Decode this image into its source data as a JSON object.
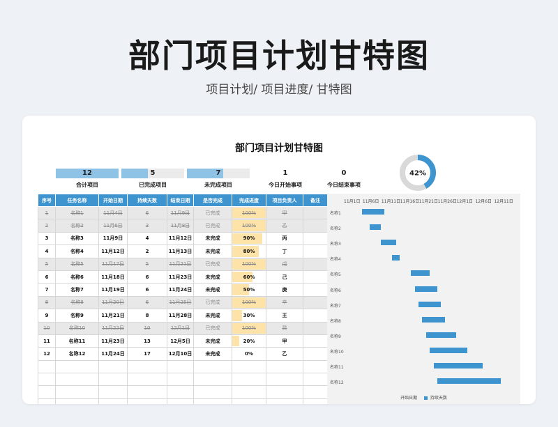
{
  "header": {
    "title": "部门项目计划甘特图",
    "subtitle": "项目计划/  项目进度/  甘特图"
  },
  "sheet": {
    "title": "部门项目计划甘特图"
  },
  "stats": [
    {
      "value": "12",
      "label": "合计项目",
      "fill": 1.0
    },
    {
      "value": "5",
      "label": "已完成项目",
      "fill": 0.42
    },
    {
      "value": "7",
      "label": "未完成项目",
      "fill": 0.58
    },
    {
      "value": "1",
      "label": "今日开始事项"
    },
    {
      "value": "0",
      "label": "今日结束事项"
    }
  ],
  "donut": {
    "percent_label": "42%",
    "fraction": 0.42,
    "color": "#3d94cf",
    "track": "#d9d9d9"
  },
  "table": {
    "headers": [
      "序号",
      "任务名称",
      "开始日期",
      "持续天数",
      "结束日期",
      "是否完成",
      "完成进度",
      "项目负责人",
      "备注"
    ],
    "rows": [
      {
        "no": "1",
        "name": "名称1",
        "start": "11月4日",
        "days": "6",
        "end": "11月9日",
        "status": "已完成",
        "progress": "100%",
        "pct": 1.0,
        "owner": "甲",
        "done": true
      },
      {
        "no": "2",
        "name": "名称2",
        "start": "11月6日",
        "days": "3",
        "end": "11月8日",
        "status": "已完成",
        "progress": "100%",
        "pct": 1.0,
        "owner": "乙",
        "done": true
      },
      {
        "no": "3",
        "name": "名称3",
        "start": "11月9日",
        "days": "4",
        "end": "11月12日",
        "status": "未完成",
        "progress": "90%",
        "pct": 0.9,
        "owner": "丙",
        "done": false
      },
      {
        "no": "4",
        "name": "名称4",
        "start": "11月12日",
        "days": "2",
        "end": "11月13日",
        "status": "未完成",
        "progress": "80%",
        "pct": 0.8,
        "owner": "丁",
        "done": false
      },
      {
        "no": "5",
        "name": "名称5",
        "start": "11月17日",
        "days": "5",
        "end": "11月21日",
        "status": "已完成",
        "progress": "100%",
        "pct": 1.0,
        "owner": "戊",
        "done": true
      },
      {
        "no": "6",
        "name": "名称6",
        "start": "11月18日",
        "days": "6",
        "end": "11月23日",
        "status": "未完成",
        "progress": "60%",
        "pct": 0.6,
        "owner": "己",
        "done": false
      },
      {
        "no": "7",
        "name": "名称7",
        "start": "11月19日",
        "days": "6",
        "end": "11月24日",
        "status": "未完成",
        "progress": "50%",
        "pct": 0.5,
        "owner": "庚",
        "done": false
      },
      {
        "no": "8",
        "name": "名称8",
        "start": "11月20日",
        "days": "6",
        "end": "11月25日",
        "status": "已完成",
        "progress": "100%",
        "pct": 1.0,
        "owner": "辛",
        "done": true
      },
      {
        "no": "9",
        "name": "名称9",
        "start": "11月21日",
        "days": "8",
        "end": "11月28日",
        "status": "未完成",
        "progress": "30%",
        "pct": 0.3,
        "owner": "王",
        "done": false
      },
      {
        "no": "10",
        "name": "名称10",
        "start": "11月22日",
        "days": "10",
        "end": "12月1日",
        "status": "已完成",
        "progress": "100%",
        "pct": 1.0,
        "owner": "癸",
        "done": true
      },
      {
        "no": "11",
        "name": "名称11",
        "start": "11月23日",
        "days": "13",
        "end": "12月5日",
        "status": "未完成",
        "progress": "20%",
        "pct": 0.2,
        "owner": "甲",
        "done": false
      },
      {
        "no": "12",
        "name": "名称12",
        "start": "11月24日",
        "days": "17",
        "end": "12月10日",
        "status": "未完成",
        "progress": "0%",
        "pct": 0.0,
        "owner": "乙",
        "done": false
      }
    ],
    "empty_rows": 4
  },
  "chart_data": {
    "type": "bar",
    "orientation": "horizontal-stacked",
    "categories": [
      "名称1",
      "名称2",
      "名称3",
      "名称4",
      "名称5",
      "名称6",
      "名称7",
      "名称8",
      "名称9",
      "名称10",
      "名称11",
      "名称12"
    ],
    "series": [
      {
        "name": "开始日期",
        "values": [
          "11月4日",
          "11月6日",
          "11月9日",
          "11月12日",
          "11月17日",
          "11月18日",
          "11月19日",
          "11月20日",
          "11月21日",
          "11月22日",
          "11月23日",
          "11月24日"
        ],
        "color": "none"
      },
      {
        "name": "持续天数",
        "values": [
          6,
          3,
          4,
          2,
          5,
          6,
          6,
          6,
          8,
          10,
          13,
          17
        ],
        "color": "#3d94cf"
      }
    ],
    "x_ticks": [
      "11月1日",
      "11月6日",
      "11月11日",
      "11月16日",
      "11月21日",
      "11月26日",
      "12月1日",
      "12月6日",
      "12月11日"
    ],
    "x_tick_days": [
      0,
      5,
      10,
      15,
      20,
      25,
      30,
      35,
      40
    ],
    "start_days": [
      3,
      5,
      8,
      11,
      16,
      17,
      18,
      19,
      20,
      21,
      22,
      23
    ],
    "xlim_days": [
      0,
      44
    ],
    "legend": [
      "开始日期",
      "持续天数"
    ],
    "legend_position": "bottom",
    "grid": false
  }
}
